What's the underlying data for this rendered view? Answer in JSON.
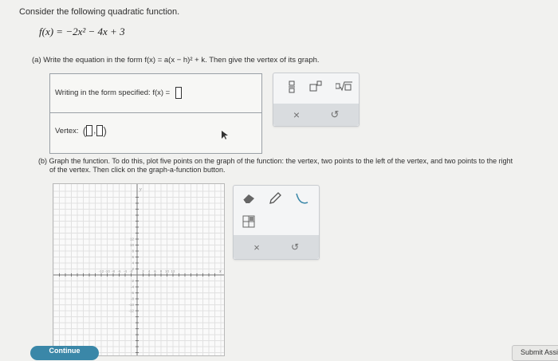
{
  "question": {
    "prompt": "Consider the following quadratic function.",
    "function": "f(x) = −2x² − 4x + 3",
    "part_a": "(a) Write the equation in the form f(x) = a(x − h)² + k. Then give the vertex of its graph.",
    "writing_label": "Writing in the form specified: f(x) =",
    "vertex_label": "Vertex:",
    "part_b_line1": "(b) Graph the function. To do this, plot five points on the graph of the function: the vertex, two points to the left of the vertex, and two points to the right",
    "part_b_line2": "of the vertex. Then click on the graph-a-function button."
  },
  "toolbar_a": {
    "fraction_icon": "fraction-icon",
    "exponent_icon": "exponent-icon",
    "sqrt_icon": "sqrt-icon",
    "clear": "×",
    "undo": "↺"
  },
  "graph": {
    "x_ticks": [
      "-12",
      "-10",
      "-8",
      "-6",
      "-4",
      "-2",
      "2",
      "4",
      "6",
      "8",
      "10",
      "12"
    ],
    "y_ticks": [
      "12",
      "10",
      "8",
      "6",
      "4",
      "2",
      "-2",
      "-4",
      "-6",
      "-8",
      "-10",
      "-12"
    ],
    "x_axis_label": "x",
    "y_axis_label": "y"
  },
  "toolbar_b": {
    "eraser_icon": "eraser-icon",
    "pencil_icon": "pencil-icon",
    "parabola_icon": "parabola-icon",
    "table_icon": "table-icon",
    "clear": "×",
    "undo": "↺"
  },
  "footer": {
    "continue": "Continue",
    "submit": "Submit Assi"
  },
  "colors": {
    "accent": "#3a87a8",
    "submit_bg": "#e8e8e6"
  }
}
